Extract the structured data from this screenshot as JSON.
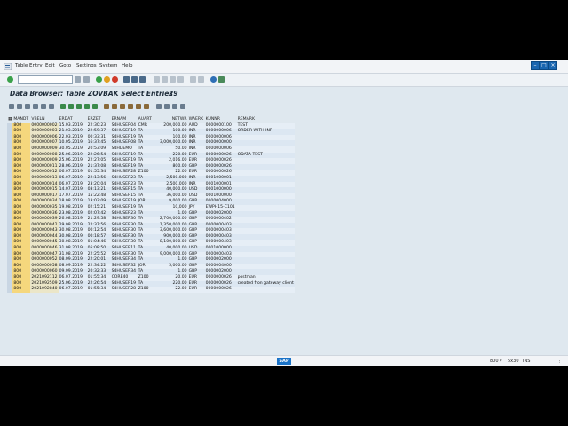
{
  "menu": [
    "Table Entry",
    "Edit",
    "Goto",
    "Settings",
    "System",
    "Help"
  ],
  "title": "Data Browser: Table ZOVBAK Select Entries",
  "entry_count": "29",
  "columns": [
    "MANDT",
    "VBELN",
    "ERDAT",
    "ERZET",
    "ERNAM",
    "AUART",
    "NETWR",
    "WAERK",
    "KUNNR",
    "REMARK"
  ],
  "rows": [
    [
      "800",
      "0000000002",
      "15.03.2019",
      "22:30:23",
      "S4HUSER04",
      "CMR",
      "200,000.00",
      "AUD",
      "0000000100",
      "TEST"
    ],
    [
      "800",
      "0000000003",
      "21.03.2019",
      "22:59:37",
      "S4HUSER19",
      "TA",
      "100.00",
      "INR",
      "0000000006",
      "ORDER WITH INR"
    ],
    [
      "800",
      "0000000006",
      "22.03.2019",
      "00:33:31",
      "S4HUSER19",
      "TA",
      "100.00",
      "INR",
      "0000000006",
      ""
    ],
    [
      "800",
      "0000000007",
      "10.05.2019",
      "16:37:45",
      "S4HUSER08",
      "TA",
      "3,000,000.00",
      "INR",
      "0000000000",
      ""
    ],
    [
      "800",
      "0000000009",
      "30.05.2019",
      "20:53:09",
      "S4HDEMO",
      "TA",
      "50.00",
      "INR",
      "0000000006",
      ""
    ],
    [
      "800",
      "0000000008",
      "25.06.2019",
      "22:26:54",
      "S4HUSER19",
      "TA",
      "220.00",
      "EUR",
      "0000000026",
      "ODATA TEST"
    ],
    [
      "800",
      "0000000009",
      "25.06.2019",
      "22:27:05",
      "S4HUSER19",
      "TA",
      "2,016.00",
      "EUR",
      "0000000026",
      ""
    ],
    [
      "800",
      "0000000011",
      "28.06.2019",
      "21:37:08",
      "S4HUSER19",
      "TA",
      "800.00",
      "GBP",
      "0000000026",
      ""
    ],
    [
      "800",
      "0000000012",
      "06.07.2019",
      "01:55:34",
      "S4HUSER28",
      "Z100",
      "22.00",
      "EUR",
      "0000000026",
      ""
    ],
    [
      "800",
      "0000000013",
      "06.07.2019",
      "22:13:56",
      "S4HUSER23",
      "TA",
      "2,500.000",
      "INR",
      "0001000001",
      ""
    ],
    [
      "800",
      "0000000014",
      "06.07.2019",
      "23:20:04",
      "S4HUSER23",
      "TA",
      "2,500.000",
      "INR",
      "0001000001",
      ""
    ],
    [
      "800",
      "0000000015",
      "14.07.2019",
      "03:13:21",
      "S4HUSER15",
      "TA",
      "40,000.00",
      "USD",
      "0001000000",
      ""
    ],
    [
      "800",
      "0000000017",
      "17.07.2019",
      "15:22:48",
      "S4HUSER15",
      "TA",
      "36,000.00",
      "USD",
      "0001000000",
      ""
    ],
    [
      "800",
      "0000000034",
      "18.08.2019",
      "13:03:09",
      "S4HUSER19",
      "JOR",
      "9,000.00",
      "GBP",
      "0000004000",
      ""
    ],
    [
      "800",
      "0000000035",
      "19.08.2019",
      "02:15:21",
      "S4HUSER19",
      "TA",
      "10,000",
      "JPY",
      "EWPH15-C101",
      ""
    ],
    [
      "800",
      "0000000036",
      "23.08.2019",
      "02:07:42",
      "S4HUSER23",
      "TA",
      "1.00",
      "GBP",
      "0000002000",
      ""
    ],
    [
      "800",
      "0000000039",
      "26.08.2019",
      "21:29:58",
      "S4HUSER30",
      "TA",
      "2,700,000.00",
      "GBP",
      "0000000402",
      ""
    ],
    [
      "800",
      "0000000042",
      "29.08.2019",
      "22:37:56",
      "S4HUSER30",
      "TA",
      "1,350,000.00",
      "GBP",
      "0000000403",
      ""
    ],
    [
      "800",
      "0000000043",
      "30.08.2019",
      "00:12:54",
      "S4HUSER30",
      "TA",
      "3,600,000.00",
      "GBP",
      "0000000403",
      ""
    ],
    [
      "800",
      "0000000044",
      "30.08.2019",
      "00:18:57",
      "S4HUSER30",
      "TA",
      "900,000.00",
      "GBP",
      "0000000403",
      ""
    ],
    [
      "800",
      "0000000045",
      "30.08.2019",
      "01:04:46",
      "S4HUSER30",
      "TA",
      "8,100,000.00",
      "GBP",
      "0000000403",
      ""
    ],
    [
      "800",
      "0000000046",
      "31.08.2019",
      "05:08:50",
      "S4HUSER11",
      "TA",
      "40,000.00",
      "USD",
      "0001000000",
      ""
    ],
    [
      "800",
      "0000000047",
      "31.08.2019",
      "22:25:52",
      "S4HUSER30",
      "TA",
      "9,000,000.00",
      "GBP",
      "0000000403",
      ""
    ],
    [
      "800",
      "0000000052",
      "08.09.2019",
      "22:20:01",
      "S4HUSER34",
      "TA",
      "1.00",
      "GBP",
      "0000002000",
      ""
    ],
    [
      "800",
      "0000000058",
      "08.09.2019",
      "22:34:22",
      "S4HUSER32",
      "JOR",
      "5,000.00",
      "GBP",
      "0000004000",
      ""
    ],
    [
      "800",
      "0000000060",
      "09.09.2019",
      "20:32:33",
      "S4HUSER34",
      "TA",
      "1.00",
      "GBP",
      "0000002000",
      ""
    ],
    [
      "800",
      "2021092112",
      "06.07.2019",
      "01:55:34",
      "CORE40",
      "Z100",
      "20.00",
      "EUR",
      "0000000026",
      "postman"
    ],
    [
      "800",
      "2021092509",
      "25.06.2019",
      "22:26:54",
      "S4HUSER19",
      "TA",
      "220.00",
      "EUR",
      "0000000026",
      "created fron gateway client"
    ],
    [
      "800",
      "2021092840",
      "06.07.2019",
      "01:55:34",
      "S4HUSER28",
      "Z100",
      "22.00",
      "EUR",
      "0000000026",
      ""
    ]
  ],
  "status": {
    "system": "800",
    "session": "5x30",
    "mode": "INS",
    "logo": "SAP"
  },
  "colors": {
    "key": "#f5d77d",
    "accent": "#1a66b0"
  },
  "icons": [
    "sap-logo-icon",
    "enter-icon",
    "save-icon",
    "back-icon",
    "exit-icon",
    "cancel-icon",
    "print-icon",
    "find-icon",
    "help-icon"
  ]
}
